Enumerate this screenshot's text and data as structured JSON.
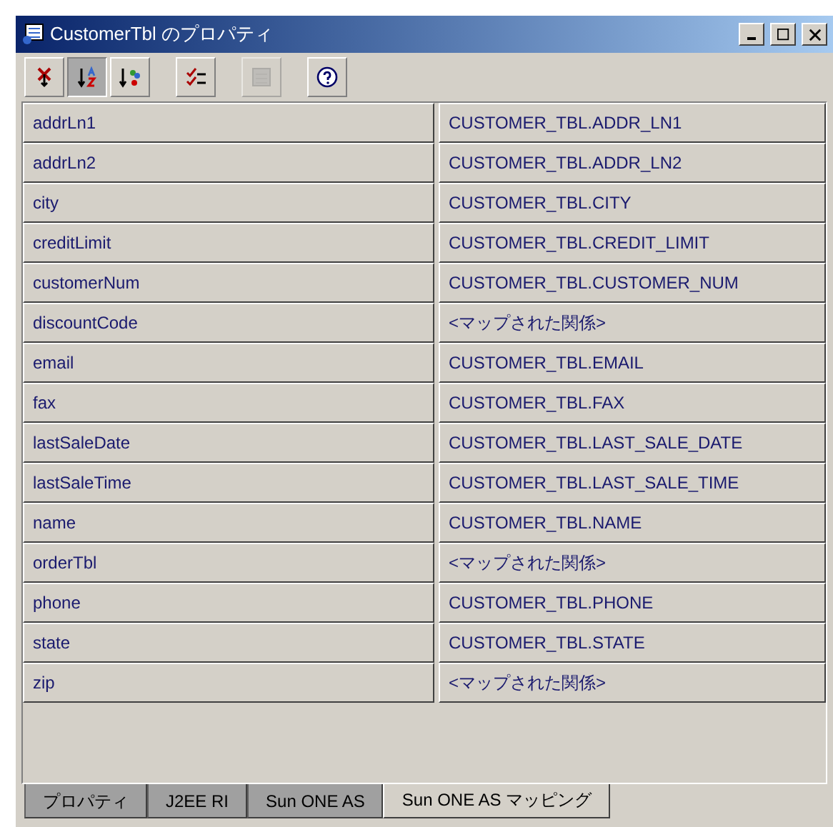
{
  "window": {
    "title": "CustomerTbl のプロパティ"
  },
  "toolbar": [
    {
      "kind": "button",
      "pressed": false,
      "disabled": false
    },
    {
      "kind": "button",
      "pressed": true,
      "disabled": false
    },
    {
      "kind": "button",
      "pressed": false,
      "disabled": false
    },
    {
      "kind": "separator"
    },
    {
      "kind": "button",
      "pressed": false,
      "disabled": false
    },
    {
      "kind": "separator"
    },
    {
      "kind": "button",
      "pressed": false,
      "disabled": true
    },
    {
      "kind": "separator"
    },
    {
      "kind": "button",
      "pressed": false,
      "disabled": false
    }
  ],
  "table": {
    "rows": [
      {
        "name": "addrLn1",
        "value": "CUSTOMER_TBL.ADDR_LN1"
      },
      {
        "name": "addrLn2",
        "value": "CUSTOMER_TBL.ADDR_LN2"
      },
      {
        "name": "city",
        "value": "CUSTOMER_TBL.CITY"
      },
      {
        "name": "creditLimit",
        "value": "CUSTOMER_TBL.CREDIT_LIMIT"
      },
      {
        "name": "customerNum",
        "value": "CUSTOMER_TBL.CUSTOMER_NUM"
      },
      {
        "name": "discountCode",
        "value": "<マップされた関係>"
      },
      {
        "name": "email",
        "value": "CUSTOMER_TBL.EMAIL"
      },
      {
        "name": "fax",
        "value": "CUSTOMER_TBL.FAX"
      },
      {
        "name": "lastSaleDate",
        "value": "CUSTOMER_TBL.LAST_SALE_DATE"
      },
      {
        "name": "lastSaleTime",
        "value": "CUSTOMER_TBL.LAST_SALE_TIME"
      },
      {
        "name": "name",
        "value": "CUSTOMER_TBL.NAME"
      },
      {
        "name": "orderTbl",
        "value": "<マップされた関係>"
      },
      {
        "name": "phone",
        "value": "CUSTOMER_TBL.PHONE"
      },
      {
        "name": "state",
        "value": "CUSTOMER_TBL.STATE"
      },
      {
        "name": "zip",
        "value": "<マップされた関係>"
      }
    ]
  },
  "tabs": [
    {
      "label": "プロパティ",
      "selected": false
    },
    {
      "label": "J2EE RI",
      "selected": false
    },
    {
      "label": "Sun ONE AS",
      "selected": false
    },
    {
      "label": "Sun ONE AS マッピング",
      "selected": true
    }
  ]
}
